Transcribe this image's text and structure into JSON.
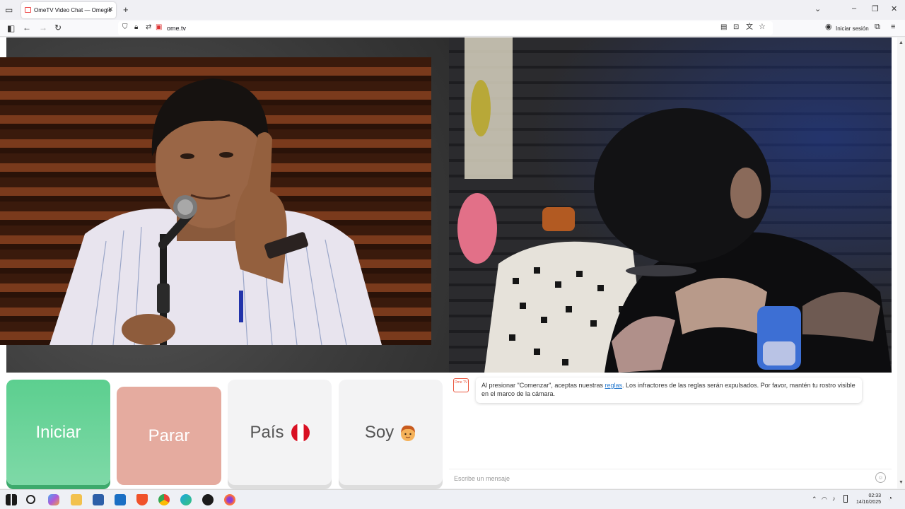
{
  "browser": {
    "tab_title": "OmeTV Video Chat — Omegle",
    "url": "ome.tv",
    "signin_label": "Iniciar sesión"
  },
  "controls": {
    "start_label": "Iniciar",
    "stop_label": "Parar",
    "country_label": "País",
    "gender_label": "Soy"
  },
  "chat": {
    "logo_text": "Ome TV",
    "notice_before": "Al presionar \"Comenzar\", aceptas nuestras",
    "rules_link": "reglas",
    "notice_after": ". Los infractores de las reglas serán expulsados. Por favor, mantén tu rostro visible en el marco de la cámara.",
    "placeholder": "Escribe un mensaje"
  },
  "taskbar": {
    "time": "02:33",
    "date": "14/10/2025"
  },
  "colors": {
    "start": "#5ccf8f",
    "stop": "#e5ab9f",
    "link": "#2a7cd0"
  }
}
